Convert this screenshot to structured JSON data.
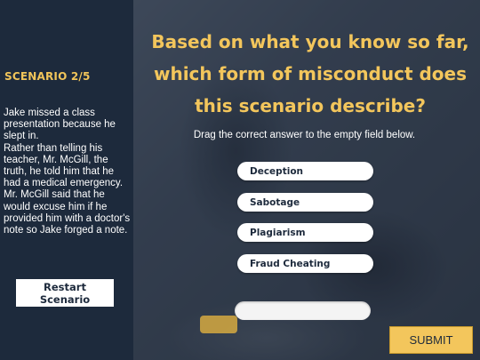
{
  "sidebar": {
    "scenario_label": "SCENARIO 2/5",
    "scenario_lines": [
      "Jake missed a class presentation because he slept in.",
      "Rather than telling his teacher, Mr. McGill, the truth, he told him that he had a medical emergency. Mr. McGill said that he would excuse him if he provided him with a doctor's note so Jake forged a note."
    ],
    "restart_label": "Restart Scenario"
  },
  "main": {
    "question": "Based on what you know so far, which form of misconduct does this scenario describe?",
    "instruction": "Drag the correct answer to the empty field below.",
    "options": [
      "Deception",
      "Sabotage",
      "Plagiarism",
      "Fraud Cheating"
    ],
    "drop_field_value": "",
    "submit_label": "SUBMIT"
  },
  "colors": {
    "accent": "#f3c65c",
    "sidebar": "#1d2a3c"
  }
}
